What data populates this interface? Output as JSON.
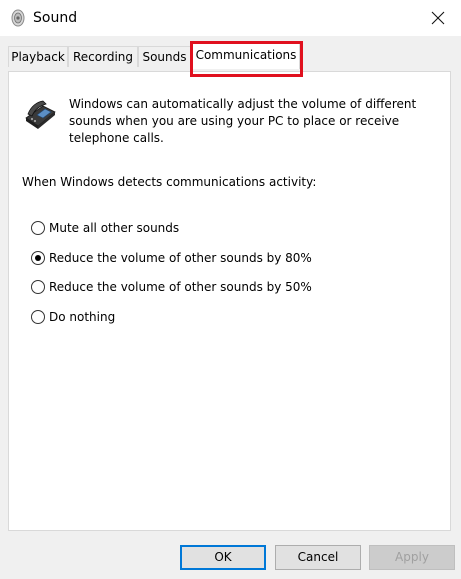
{
  "window": {
    "title": "Sound",
    "close_icon": "close-icon",
    "title_icon": "speaker-icon"
  },
  "tabs": [
    {
      "label": "Playback",
      "active": false
    },
    {
      "label": "Recording",
      "active": false
    },
    {
      "label": "Sounds",
      "active": false
    },
    {
      "label": "Communications",
      "active": true
    }
  ],
  "highlight_color": "#e0101e",
  "communications": {
    "icon": "telephone-icon",
    "description": "Windows can automatically adjust the volume of different sounds when you are using your PC to place or receive telephone calls.",
    "detect_label": "When Windows detects communications activity:",
    "options": [
      {
        "label": "Mute all other sounds",
        "checked": false
      },
      {
        "label": "Reduce the volume of other sounds by 80%",
        "checked": true
      },
      {
        "label": "Reduce the volume of other sounds by 50%",
        "checked": false
      },
      {
        "label": "Do nothing",
        "checked": false
      }
    ]
  },
  "buttons": {
    "ok": "OK",
    "cancel": "Cancel",
    "apply": "Apply"
  },
  "accent_color": "#0078d7"
}
